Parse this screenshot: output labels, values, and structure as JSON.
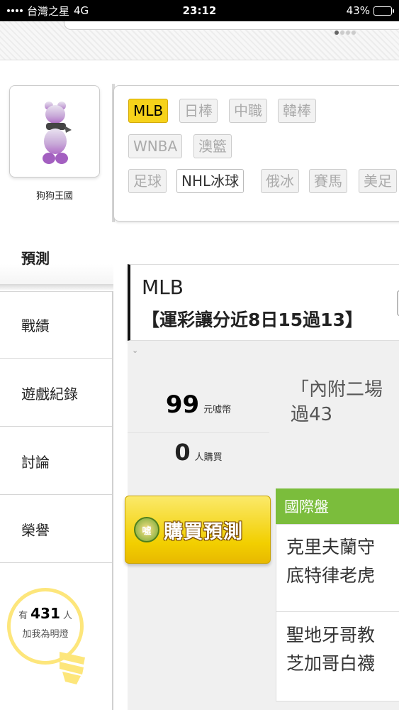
{
  "status_bar": {
    "carrier": "台灣之星",
    "network": "4G",
    "time": "23:12",
    "battery": "43%",
    "battery_level": 0.43
  },
  "profile": {
    "username": "狗狗王國"
  },
  "categories": {
    "row1": [
      "MLB",
      "日棒",
      "中職",
      "韓棒"
    ],
    "row2": [
      "WNBA",
      "澳籃"
    ],
    "row3": [
      "足球",
      "NHL冰球",
      "俄冰",
      "賽馬",
      "美足"
    ],
    "active": "MLB"
  },
  "tabs": [
    "預測",
    "戰績",
    "遊戲紀錄",
    "討論",
    "榮譽"
  ],
  "prediction": {
    "league": "MLB",
    "title": "【運彩讓分近8日15過13】",
    "price": "99",
    "price_unit": "元噓幣",
    "buyers": "0",
    "buyers_unit": "人購買",
    "description": "「內附二場\n過43",
    "buy_button": "購買預測",
    "buy_badge": "噓"
  },
  "market": {
    "title": "國際盤",
    "matches": [
      "克里夫蘭守\n底特律老虎",
      "聖地牙哥教\n芝加哥白襪"
    ]
  },
  "fans": {
    "prefix": "有",
    "count": "431",
    "suffix": "人",
    "label": "加我為明燈"
  },
  "colors": {
    "active_tag": "#f6d21a",
    "market_header": "#7bbd3c",
    "buy_button": "#f2cf00"
  }
}
